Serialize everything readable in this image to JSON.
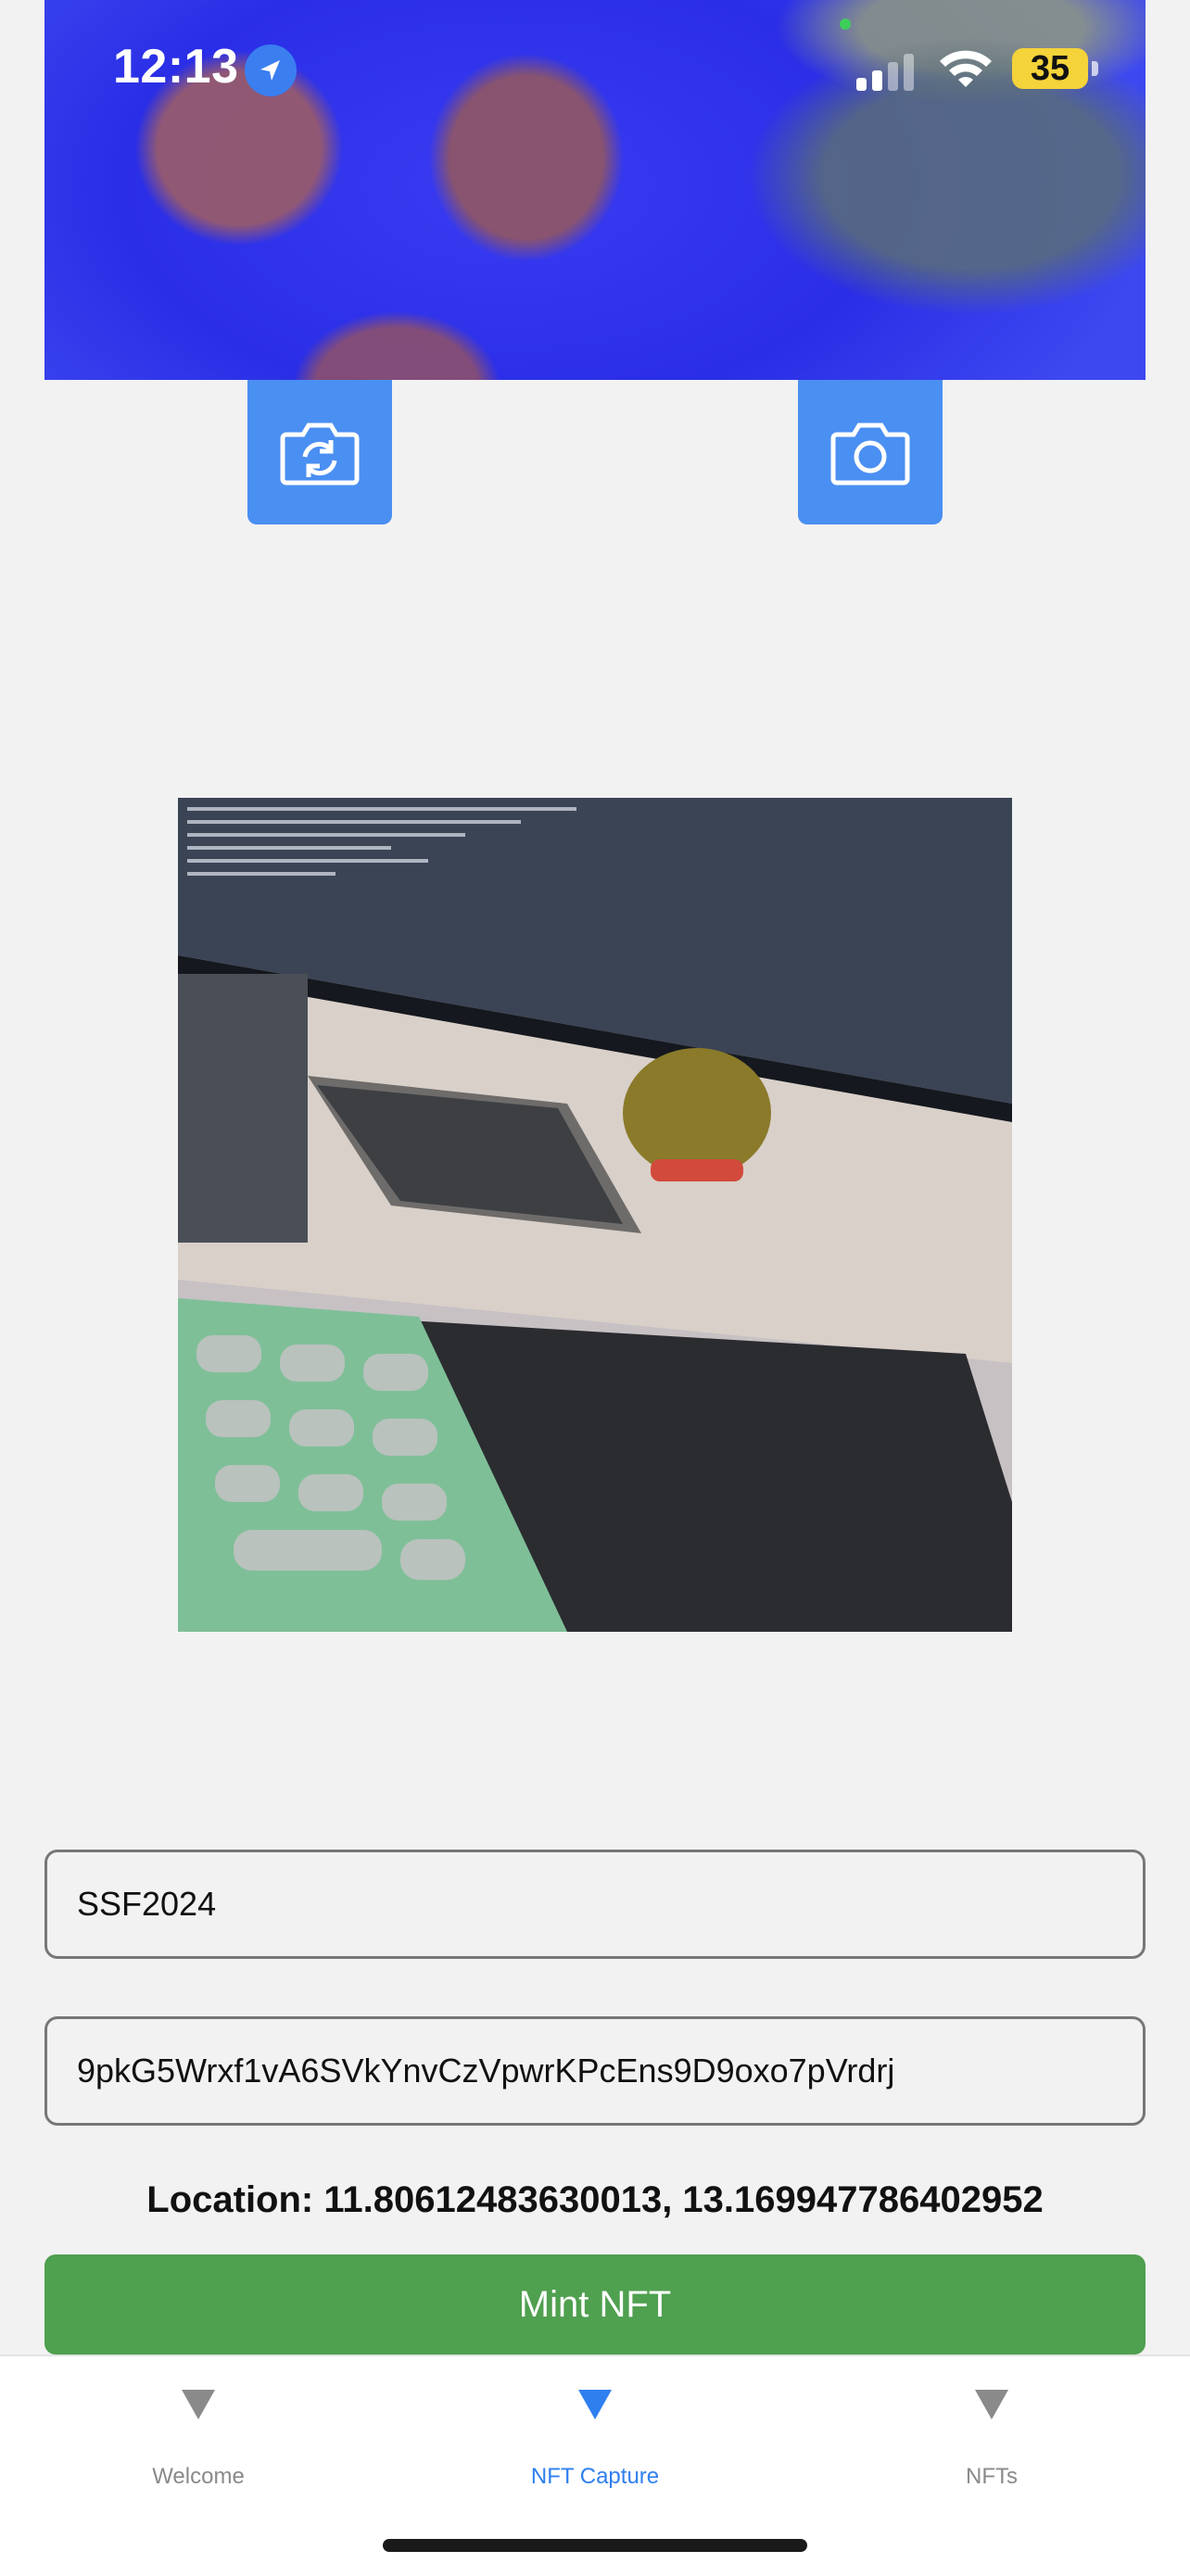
{
  "status_bar": {
    "time": "12:13",
    "battery": "35",
    "icons": [
      "location-arrow-icon",
      "cellular-signal-icon",
      "wifi-icon",
      "battery-icon"
    ]
  },
  "camera": {
    "flip_icon": "camera-flip-icon",
    "capture_icon": "camera-icon"
  },
  "form": {
    "name_value": "SSF2024",
    "wallet_value": "9pkG5Wrxf1vA6SVkYnvCzVpwrKPcEns9D9oxo7pVrdrj",
    "location_text": "Location: 11.80612483630013, 13.169947786402952",
    "mint_label": "Mint NFT"
  },
  "tabs": [
    {
      "label": "Welcome",
      "active": false
    },
    {
      "label": "NFT Capture",
      "active": true
    },
    {
      "label": "NFTs",
      "active": false
    }
  ],
  "colors": {
    "primary_button": "#4a8ff2",
    "mint_button": "#4fa04f",
    "active_tab": "#2f7fef",
    "inactive_tab": "#8a8a8a",
    "background": "#f2f2f2"
  }
}
